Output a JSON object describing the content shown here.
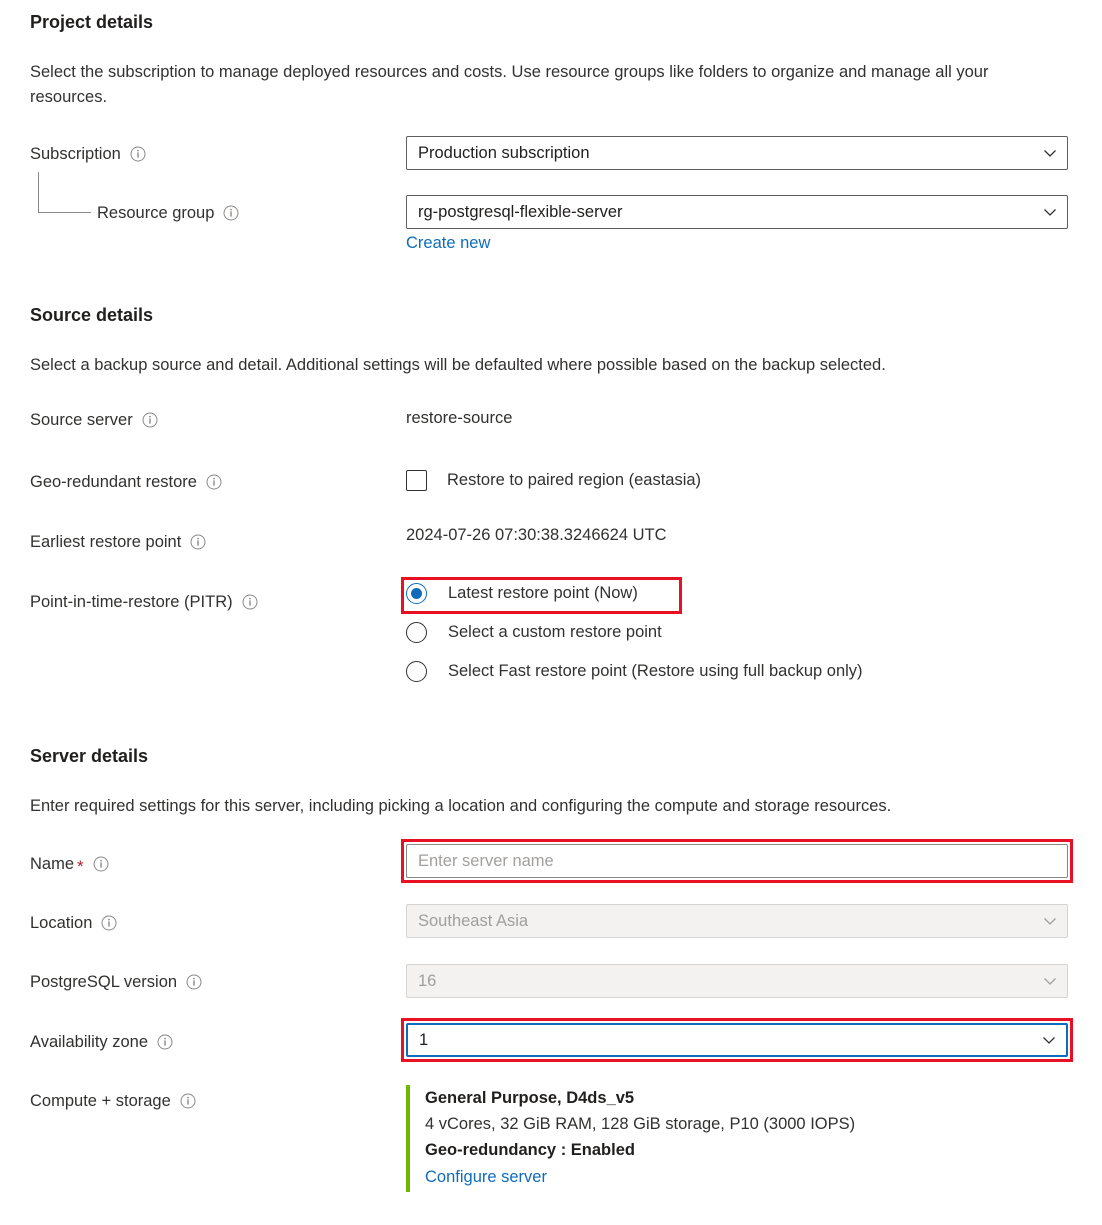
{
  "project_details": {
    "heading": "Project details",
    "description": "Select the subscription to manage deployed resources and costs. Use resource groups like folders to organize and manage all your resources.",
    "subscription": {
      "label": "Subscription",
      "value": "Production subscription"
    },
    "resource_group": {
      "label": "Resource group",
      "value": "rg-postgresql-flexible-server",
      "create_new_link": "Create new"
    }
  },
  "source_details": {
    "heading": "Source details",
    "description": "Select a backup source and detail. Additional settings will be defaulted where possible based on the backup selected.",
    "source_server": {
      "label": "Source server",
      "value": "restore-source"
    },
    "geo_redundant_restore": {
      "label": "Geo-redundant restore",
      "checkbox_label": "Restore to paired region (eastasia)",
      "checked": false
    },
    "earliest_restore_point": {
      "label": "Earliest restore point",
      "value": "2024-07-26 07:30:38.3246624 UTC"
    },
    "pitr": {
      "label": "Point-in-time-restore (PITR)",
      "options": [
        {
          "label": "Latest restore point (Now)",
          "selected": true
        },
        {
          "label": "Select a custom restore point",
          "selected": false
        },
        {
          "label": "Select Fast restore point (Restore using full backup only)",
          "selected": false
        }
      ]
    }
  },
  "server_details": {
    "heading": "Server details",
    "description": "Enter required settings for this server, including picking a location and configuring the compute and storage resources.",
    "name": {
      "label": "Name",
      "required_marker": "*",
      "value": "",
      "placeholder": "Enter server name"
    },
    "location": {
      "label": "Location",
      "value": "Southeast Asia",
      "disabled": true
    },
    "postgresql_version": {
      "label": "PostgreSQL version",
      "value": "16",
      "disabled": true
    },
    "availability_zone": {
      "label": "Availability zone",
      "value": "1",
      "focused": true
    },
    "compute_storage": {
      "label": "Compute + storage",
      "tier": "General Purpose, D4ds_v5",
      "specs": "4 vCores, 32 GiB RAM, 128 GiB storage, P10 (3000 IOPS)",
      "geo_redundancy": "Geo-redundancy : Enabled",
      "configure_link": "Configure server"
    }
  },
  "colors": {
    "accent_link": "#0f6cbd",
    "annotation": "#e81123",
    "summary_bar": "#6bb700",
    "required": "#a4262c"
  },
  "icons": {
    "info": "info-icon",
    "chevron_down": "chevron-down-icon"
  }
}
